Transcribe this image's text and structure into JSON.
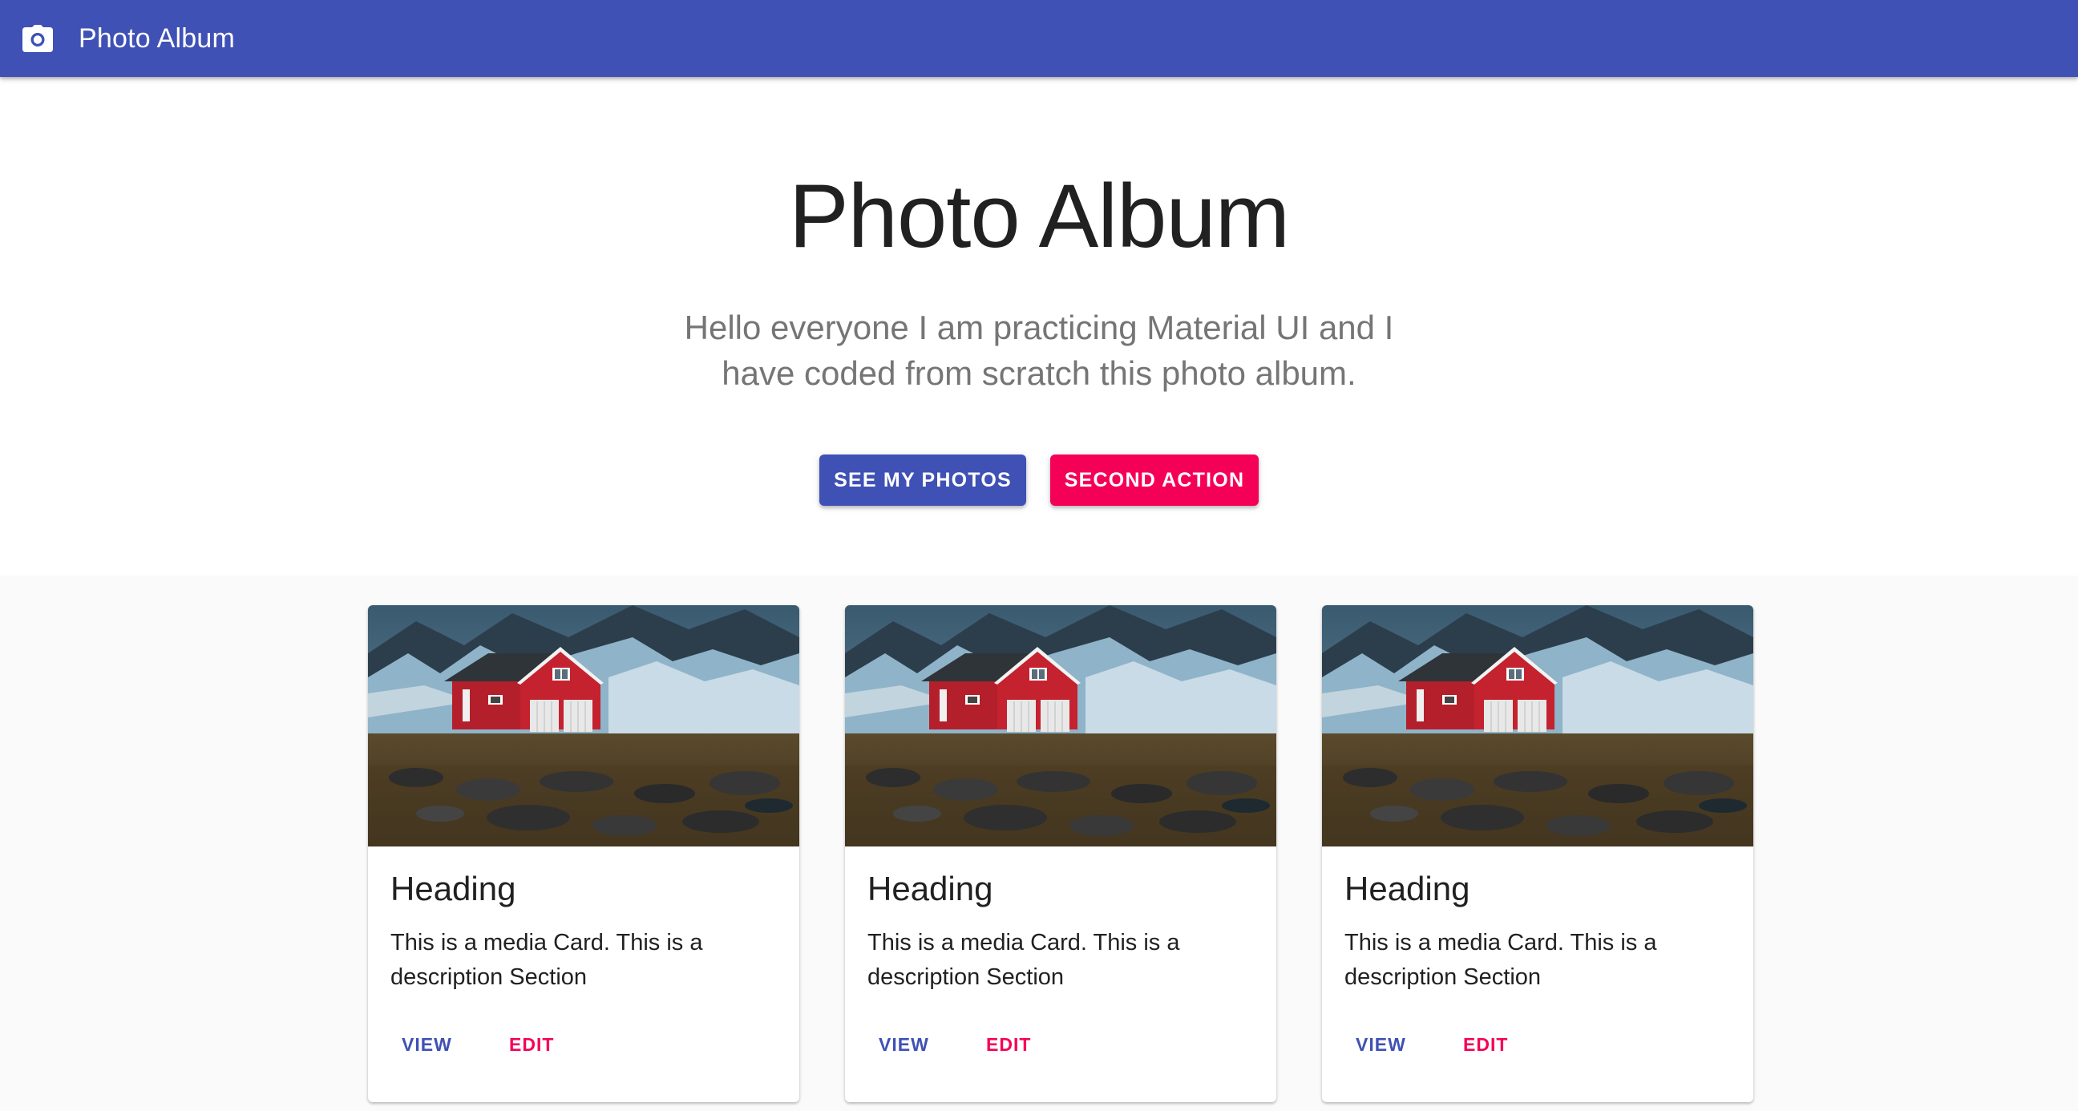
{
  "appbar": {
    "icon": "camera-icon",
    "title": "Photo Album",
    "color": "#3f51b5"
  },
  "hero": {
    "title": "Photo Album",
    "subtitle": "Hello everyone I am practicing Material UI and I have coded from scratch this photo album.",
    "primary_button": "SEE MY PHOTOS",
    "secondary_button": "SECOND ACTION",
    "primary_color": "#3f51b5",
    "secondary_color": "#f50057"
  },
  "cards": [
    {
      "image": "red-house-photo",
      "heading": "Heading",
      "description": "This is a media Card. This is a description Section",
      "view_label": "VIEW",
      "edit_label": "EDIT"
    },
    {
      "image": "red-house-photo",
      "heading": "Heading",
      "description": "This is a media Card. This is a description Section",
      "view_label": "VIEW",
      "edit_label": "EDIT"
    },
    {
      "image": "red-house-photo",
      "heading": "Heading",
      "description": "This is a media Card. This is a description Section",
      "view_label": "VIEW",
      "edit_label": "EDIT"
    }
  ]
}
